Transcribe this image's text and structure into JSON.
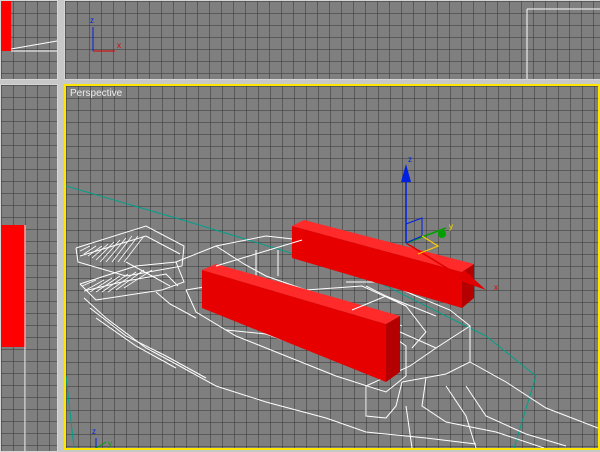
{
  "viewports": {
    "perspective": {
      "label": "Perspective",
      "active": true,
      "border_color": "#ffe600"
    }
  },
  "axis": {
    "x": "x",
    "y": "y",
    "z": "z"
  },
  "colors": {
    "viewport_bg": "#7f7f7f",
    "grid": "#3a3a3a",
    "wireframe": "#ffffff",
    "selected_object": "#ff0000",
    "horizon_line": "#00a08a",
    "axis_x": "#e00000",
    "axis_y": "#00a000",
    "axis_z": "#0020e0"
  },
  "icons": [
    "move-gizmo-icon",
    "axis-tripod-icon"
  ]
}
